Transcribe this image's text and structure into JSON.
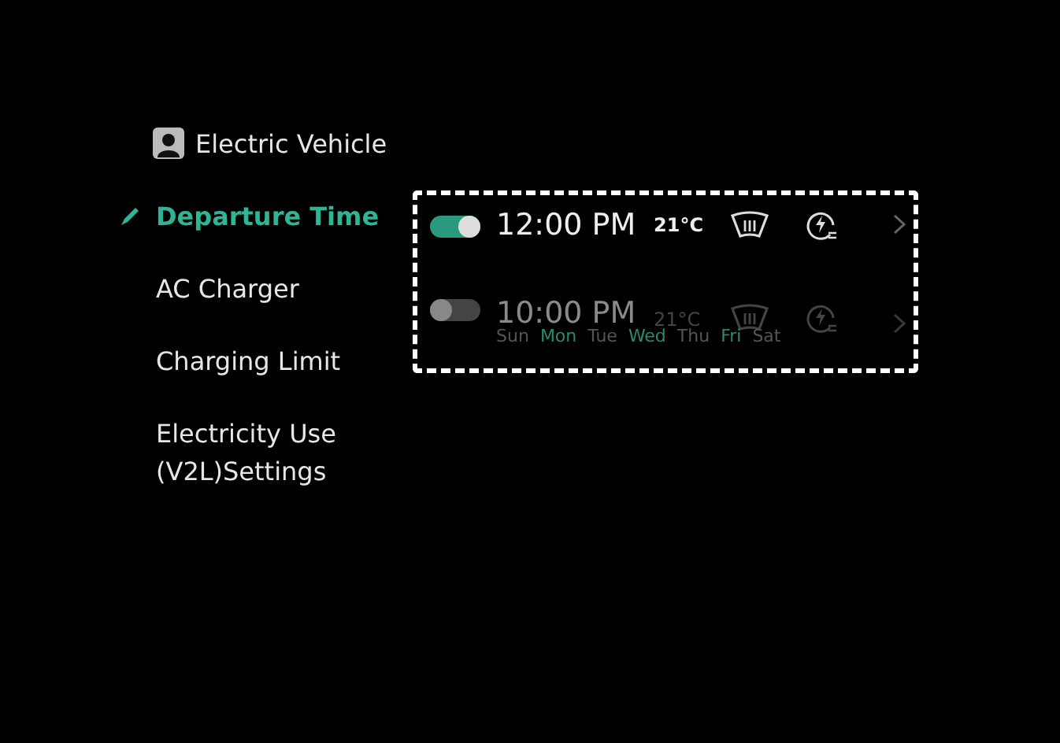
{
  "sidebar": {
    "header": {
      "label": "Electric Vehicle"
    },
    "items": [
      {
        "label": "Departure Time",
        "selected": true
      },
      {
        "label": "AC Charger",
        "selected": false
      },
      {
        "label": "Charging Limit",
        "selected": false
      },
      {
        "label": "Electricity Use\n(V2L)Settings",
        "selected": false
      }
    ]
  },
  "schedules": [
    {
      "on": true,
      "time": "12:00 PM",
      "temperature": "21°C"
    },
    {
      "on": false,
      "time": "10:00 PM",
      "temperature": "21°C",
      "days": [
        {
          "label": "Sun",
          "selected": false
        },
        {
          "label": "Mon",
          "selected": true
        },
        {
          "label": "Tue",
          "selected": false
        },
        {
          "label": "Wed",
          "selected": true
        },
        {
          "label": "Thu",
          "selected": false
        },
        {
          "label": "Fri",
          "selected": true
        },
        {
          "label": "Sat",
          "selected": false
        }
      ]
    }
  ]
}
